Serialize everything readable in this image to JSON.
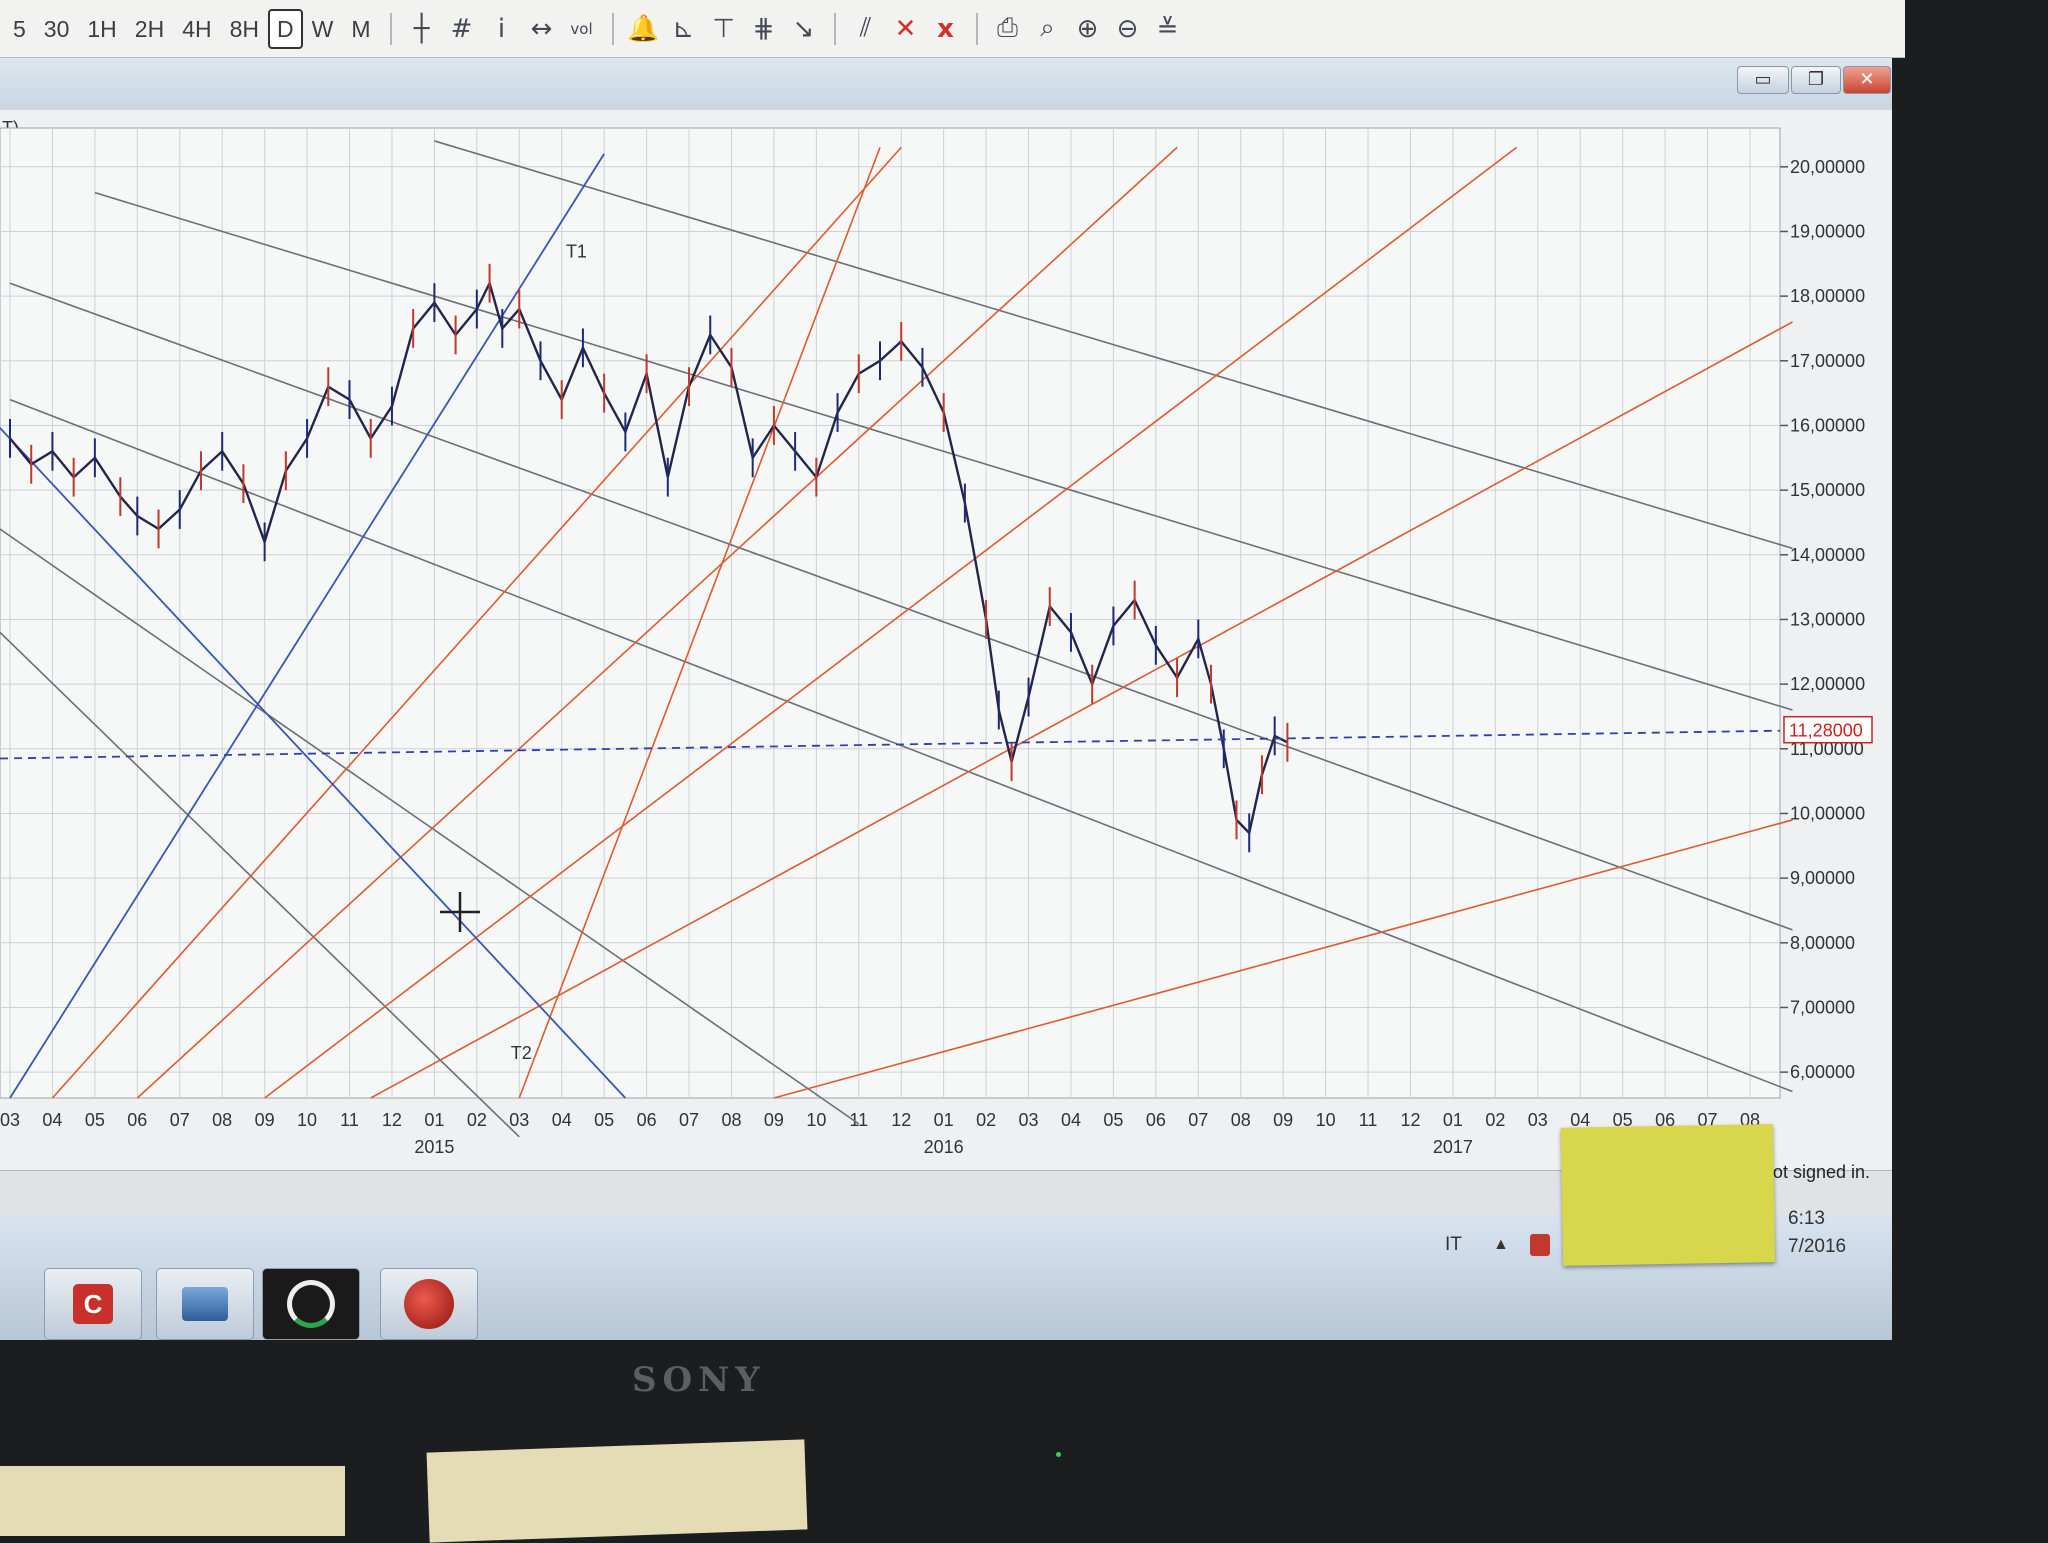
{
  "toolbar": {
    "timeframes": [
      {
        "label": "5",
        "active": false
      },
      {
        "label": "30",
        "active": false
      },
      {
        "label": "1H",
        "active": false
      },
      {
        "label": "2H",
        "active": false
      },
      {
        "label": "4H",
        "active": false
      },
      {
        "label": "8H",
        "active": false
      },
      {
        "label": "D",
        "active": true
      },
      {
        "label": "W",
        "active": false
      },
      {
        "label": "M",
        "active": false
      }
    ],
    "tools": [
      {
        "name": "crosshair-icon",
        "glyph": "┼"
      },
      {
        "name": "grid-icon",
        "glyph": "#"
      },
      {
        "name": "info-icon",
        "glyph": "i"
      },
      {
        "name": "arrows-icon",
        "glyph": "↔"
      },
      {
        "name": "vol-icon",
        "glyph": "vol"
      },
      {
        "name": "bell-icon",
        "glyph": "🔔"
      },
      {
        "name": "line-tool-1-icon",
        "glyph": "⊾"
      },
      {
        "name": "line-tool-2-icon",
        "glyph": "⊤"
      },
      {
        "name": "fork-icon",
        "glyph": "⋕"
      },
      {
        "name": "arrow-tool-icon",
        "glyph": "↘"
      },
      {
        "name": "parallel-icon",
        "glyph": "⫽"
      },
      {
        "name": "delete-icon",
        "glyph": "✕"
      },
      {
        "name": "delete-all-icon",
        "glyph": "x"
      },
      {
        "name": "print-icon",
        "glyph": "⎙"
      },
      {
        "name": "zoom-icon",
        "glyph": "⌕"
      },
      {
        "name": "zoom-in-icon",
        "glyph": "⊕"
      },
      {
        "name": "zoom-out-icon",
        "glyph": "⊖"
      },
      {
        "name": "align-icon",
        "glyph": "≚"
      }
    ]
  },
  "window": {
    "title_fragment": "T)",
    "minimize": "▭",
    "restore": "❐",
    "close": "✕"
  },
  "chart_data": {
    "type": "line",
    "y_axis": {
      "ticks": [
        "20,00000",
        "19,00000",
        "18,00000",
        "17,00000",
        "16,00000",
        "15,00000",
        "14,00000",
        "13,00000",
        "12,00000",
        "11,00000",
        "10,00000",
        "9,00000",
        "8,00000",
        "7,00000",
        "6,00000"
      ],
      "tick_values": [
        20,
        19,
        18,
        17,
        16,
        15,
        14,
        13,
        12,
        11,
        10,
        9,
        8,
        7,
        6
      ]
    },
    "x_axis": {
      "month_labels": [
        "03",
        "04",
        "05",
        "06",
        "07",
        "08",
        "09",
        "10",
        "11",
        "12",
        "01",
        "02",
        "03",
        "04",
        "05",
        "06",
        "07",
        "08",
        "09",
        "10",
        "11",
        "12",
        "01",
        "02",
        "03",
        "04",
        "05",
        "06",
        "07",
        "08",
        "09",
        "10",
        "11",
        "12",
        "01",
        "02",
        "03",
        "04",
        "05",
        "06",
        "07",
        "08"
      ],
      "year_labels": [
        {
          "label": "2015",
          "at_month_index": 10
        },
        {
          "label": "2016",
          "at_month_index": 22
        },
        {
          "label": "2017",
          "at_month_index": 34
        }
      ]
    },
    "current_price_label": "11,28000",
    "current_price": 11.28,
    "series": [
      {
        "month": 0,
        "value": 15.8
      },
      {
        "month": 0.5,
        "value": 15.4
      },
      {
        "month": 1,
        "value": 15.6
      },
      {
        "month": 1.5,
        "value": 15.2
      },
      {
        "month": 2,
        "value": 15.5
      },
      {
        "month": 2.6,
        "value": 14.9
      },
      {
        "month": 3,
        "value": 14.6
      },
      {
        "month": 3.5,
        "value": 14.4
      },
      {
        "month": 4,
        "value": 14.7
      },
      {
        "month": 4.5,
        "value": 15.3
      },
      {
        "month": 5,
        "value": 15.6
      },
      {
        "month": 5.5,
        "value": 15.1
      },
      {
        "month": 6,
        "value": 14.2
      },
      {
        "month": 6.5,
        "value": 15.3
      },
      {
        "month": 7,
        "value": 15.8
      },
      {
        "month": 7.5,
        "value": 16.6
      },
      {
        "month": 8,
        "value": 16.4
      },
      {
        "month": 8.5,
        "value": 15.8
      },
      {
        "month": 9,
        "value": 16.3
      },
      {
        "month": 9.5,
        "value": 17.5
      },
      {
        "month": 10,
        "value": 17.9
      },
      {
        "month": 10.5,
        "value": 17.4
      },
      {
        "month": 11,
        "value": 17.8
      },
      {
        "month": 11.3,
        "value": 18.2
      },
      {
        "month": 11.6,
        "value": 17.5
      },
      {
        "month": 12,
        "value": 17.8
      },
      {
        "month": 12.5,
        "value": 17.0
      },
      {
        "month": 13,
        "value": 16.4
      },
      {
        "month": 13.5,
        "value": 17.2
      },
      {
        "month": 14,
        "value": 16.5
      },
      {
        "month": 14.5,
        "value": 15.9
      },
      {
        "month": 15,
        "value": 16.8
      },
      {
        "month": 15.5,
        "value": 15.2
      },
      {
        "month": 16,
        "value": 16.6
      },
      {
        "month": 16.5,
        "value": 17.4
      },
      {
        "month": 17,
        "value": 16.9
      },
      {
        "month": 17.5,
        "value": 15.5
      },
      {
        "month": 18,
        "value": 16.0
      },
      {
        "month": 18.5,
        "value": 15.6
      },
      {
        "month": 19,
        "value": 15.2
      },
      {
        "month": 19.5,
        "value": 16.2
      },
      {
        "month": 20,
        "value": 16.8
      },
      {
        "month": 20.5,
        "value": 17.0
      },
      {
        "month": 21,
        "value": 17.3
      },
      {
        "month": 21.5,
        "value": 16.9
      },
      {
        "month": 22,
        "value": 16.2
      },
      {
        "month": 22.5,
        "value": 14.8
      },
      {
        "month": 23,
        "value": 13.0
      },
      {
        "month": 23.3,
        "value": 11.6
      },
      {
        "month": 23.6,
        "value": 10.8
      },
      {
        "month": 24,
        "value": 11.8
      },
      {
        "month": 24.5,
        "value": 13.2
      },
      {
        "month": 25,
        "value": 12.8
      },
      {
        "month": 25.5,
        "value": 12.0
      },
      {
        "month": 26,
        "value": 12.9
      },
      {
        "month": 26.5,
        "value": 13.3
      },
      {
        "month": 27,
        "value": 12.6
      },
      {
        "month": 27.5,
        "value": 12.1
      },
      {
        "month": 28,
        "value": 12.7
      },
      {
        "month": 28.3,
        "value": 12.0
      },
      {
        "month": 28.6,
        "value": 11.0
      },
      {
        "month": 28.9,
        "value": 9.9
      },
      {
        "month": 29.2,
        "value": 9.7
      },
      {
        "month": 29.5,
        "value": 10.6
      },
      {
        "month": 29.8,
        "value": 11.2
      },
      {
        "month": 30.1,
        "value": 11.1
      }
    ],
    "trendlines": [
      {
        "label": "T1",
        "color": "#3a55b4"
      },
      {
        "label": "T2",
        "color": "#3a55b4"
      }
    ]
  },
  "status": {
    "not_signed": "not signed in."
  },
  "tray": {
    "lang": "IT",
    "arrow": "▲",
    "time_fragment": "6:13",
    "date_fragment": "7/2016"
  },
  "bezel": {
    "brand": "SONY"
  }
}
